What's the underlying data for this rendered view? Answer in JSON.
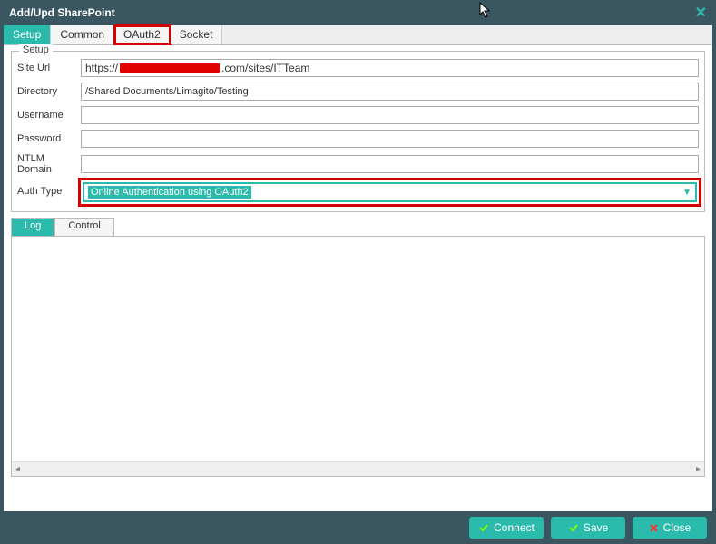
{
  "window": {
    "title": "Add/Upd SharePoint"
  },
  "tabs": {
    "setup": "Setup",
    "common": "Common",
    "oauth2": "OAuth2",
    "socket": "Socket"
  },
  "fieldset": {
    "legend": "Setup",
    "labels": {
      "siteurl": "Site Url",
      "directory": "Directory",
      "username": "Username",
      "password": "Password",
      "ntlm": "NTLM Domain",
      "authtype": "Auth Type"
    },
    "values": {
      "siteurl_prefix": "https://",
      "siteurl_suffix": ".com/sites/ITTeam",
      "directory": "/Shared Documents/Limagito/Testing",
      "username": "",
      "password": "",
      "ntlm": "",
      "authtype_selected": "Online Authentication using OAuth2"
    }
  },
  "logtabs": {
    "log": "Log",
    "control": "Control"
  },
  "buttons": {
    "connect": "Connect",
    "save": "Save",
    "close": "Close"
  }
}
